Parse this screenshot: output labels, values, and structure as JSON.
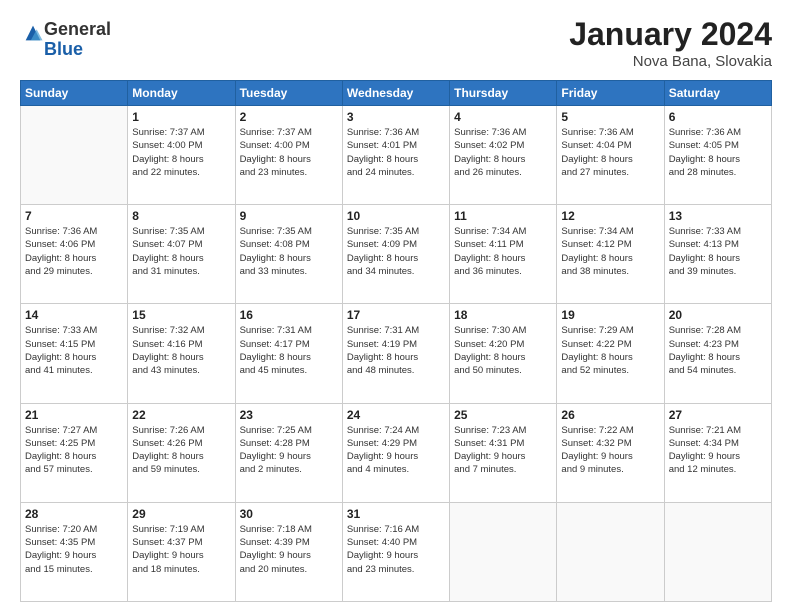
{
  "header": {
    "logo_general": "General",
    "logo_blue": "Blue",
    "month": "January 2024",
    "location": "Nova Bana, Slovakia"
  },
  "days_of_week": [
    "Sunday",
    "Monday",
    "Tuesday",
    "Wednesday",
    "Thursday",
    "Friday",
    "Saturday"
  ],
  "weeks": [
    [
      {
        "day": "",
        "info": ""
      },
      {
        "day": "1",
        "info": "Sunrise: 7:37 AM\nSunset: 4:00 PM\nDaylight: 8 hours\nand 22 minutes."
      },
      {
        "day": "2",
        "info": "Sunrise: 7:37 AM\nSunset: 4:00 PM\nDaylight: 8 hours\nand 23 minutes."
      },
      {
        "day": "3",
        "info": "Sunrise: 7:36 AM\nSunset: 4:01 PM\nDaylight: 8 hours\nand 24 minutes."
      },
      {
        "day": "4",
        "info": "Sunrise: 7:36 AM\nSunset: 4:02 PM\nDaylight: 8 hours\nand 26 minutes."
      },
      {
        "day": "5",
        "info": "Sunrise: 7:36 AM\nSunset: 4:04 PM\nDaylight: 8 hours\nand 27 minutes."
      },
      {
        "day": "6",
        "info": "Sunrise: 7:36 AM\nSunset: 4:05 PM\nDaylight: 8 hours\nand 28 minutes."
      }
    ],
    [
      {
        "day": "7",
        "info": "Sunrise: 7:36 AM\nSunset: 4:06 PM\nDaylight: 8 hours\nand 29 minutes."
      },
      {
        "day": "8",
        "info": "Sunrise: 7:35 AM\nSunset: 4:07 PM\nDaylight: 8 hours\nand 31 minutes."
      },
      {
        "day": "9",
        "info": "Sunrise: 7:35 AM\nSunset: 4:08 PM\nDaylight: 8 hours\nand 33 minutes."
      },
      {
        "day": "10",
        "info": "Sunrise: 7:35 AM\nSunset: 4:09 PM\nDaylight: 8 hours\nand 34 minutes."
      },
      {
        "day": "11",
        "info": "Sunrise: 7:34 AM\nSunset: 4:11 PM\nDaylight: 8 hours\nand 36 minutes."
      },
      {
        "day": "12",
        "info": "Sunrise: 7:34 AM\nSunset: 4:12 PM\nDaylight: 8 hours\nand 38 minutes."
      },
      {
        "day": "13",
        "info": "Sunrise: 7:33 AM\nSunset: 4:13 PM\nDaylight: 8 hours\nand 39 minutes."
      }
    ],
    [
      {
        "day": "14",
        "info": "Sunrise: 7:33 AM\nSunset: 4:15 PM\nDaylight: 8 hours\nand 41 minutes."
      },
      {
        "day": "15",
        "info": "Sunrise: 7:32 AM\nSunset: 4:16 PM\nDaylight: 8 hours\nand 43 minutes."
      },
      {
        "day": "16",
        "info": "Sunrise: 7:31 AM\nSunset: 4:17 PM\nDaylight: 8 hours\nand 45 minutes."
      },
      {
        "day": "17",
        "info": "Sunrise: 7:31 AM\nSunset: 4:19 PM\nDaylight: 8 hours\nand 48 minutes."
      },
      {
        "day": "18",
        "info": "Sunrise: 7:30 AM\nSunset: 4:20 PM\nDaylight: 8 hours\nand 50 minutes."
      },
      {
        "day": "19",
        "info": "Sunrise: 7:29 AM\nSunset: 4:22 PM\nDaylight: 8 hours\nand 52 minutes."
      },
      {
        "day": "20",
        "info": "Sunrise: 7:28 AM\nSunset: 4:23 PM\nDaylight: 8 hours\nand 54 minutes."
      }
    ],
    [
      {
        "day": "21",
        "info": "Sunrise: 7:27 AM\nSunset: 4:25 PM\nDaylight: 8 hours\nand 57 minutes."
      },
      {
        "day": "22",
        "info": "Sunrise: 7:26 AM\nSunset: 4:26 PM\nDaylight: 8 hours\nand 59 minutes."
      },
      {
        "day": "23",
        "info": "Sunrise: 7:25 AM\nSunset: 4:28 PM\nDaylight: 9 hours\nand 2 minutes."
      },
      {
        "day": "24",
        "info": "Sunrise: 7:24 AM\nSunset: 4:29 PM\nDaylight: 9 hours\nand 4 minutes."
      },
      {
        "day": "25",
        "info": "Sunrise: 7:23 AM\nSunset: 4:31 PM\nDaylight: 9 hours\nand 7 minutes."
      },
      {
        "day": "26",
        "info": "Sunrise: 7:22 AM\nSunset: 4:32 PM\nDaylight: 9 hours\nand 9 minutes."
      },
      {
        "day": "27",
        "info": "Sunrise: 7:21 AM\nSunset: 4:34 PM\nDaylight: 9 hours\nand 12 minutes."
      }
    ],
    [
      {
        "day": "28",
        "info": "Sunrise: 7:20 AM\nSunset: 4:35 PM\nDaylight: 9 hours\nand 15 minutes."
      },
      {
        "day": "29",
        "info": "Sunrise: 7:19 AM\nSunset: 4:37 PM\nDaylight: 9 hours\nand 18 minutes."
      },
      {
        "day": "30",
        "info": "Sunrise: 7:18 AM\nSunset: 4:39 PM\nDaylight: 9 hours\nand 20 minutes."
      },
      {
        "day": "31",
        "info": "Sunrise: 7:16 AM\nSunset: 4:40 PM\nDaylight: 9 hours\nand 23 minutes."
      },
      {
        "day": "",
        "info": ""
      },
      {
        "day": "",
        "info": ""
      },
      {
        "day": "",
        "info": ""
      }
    ]
  ]
}
